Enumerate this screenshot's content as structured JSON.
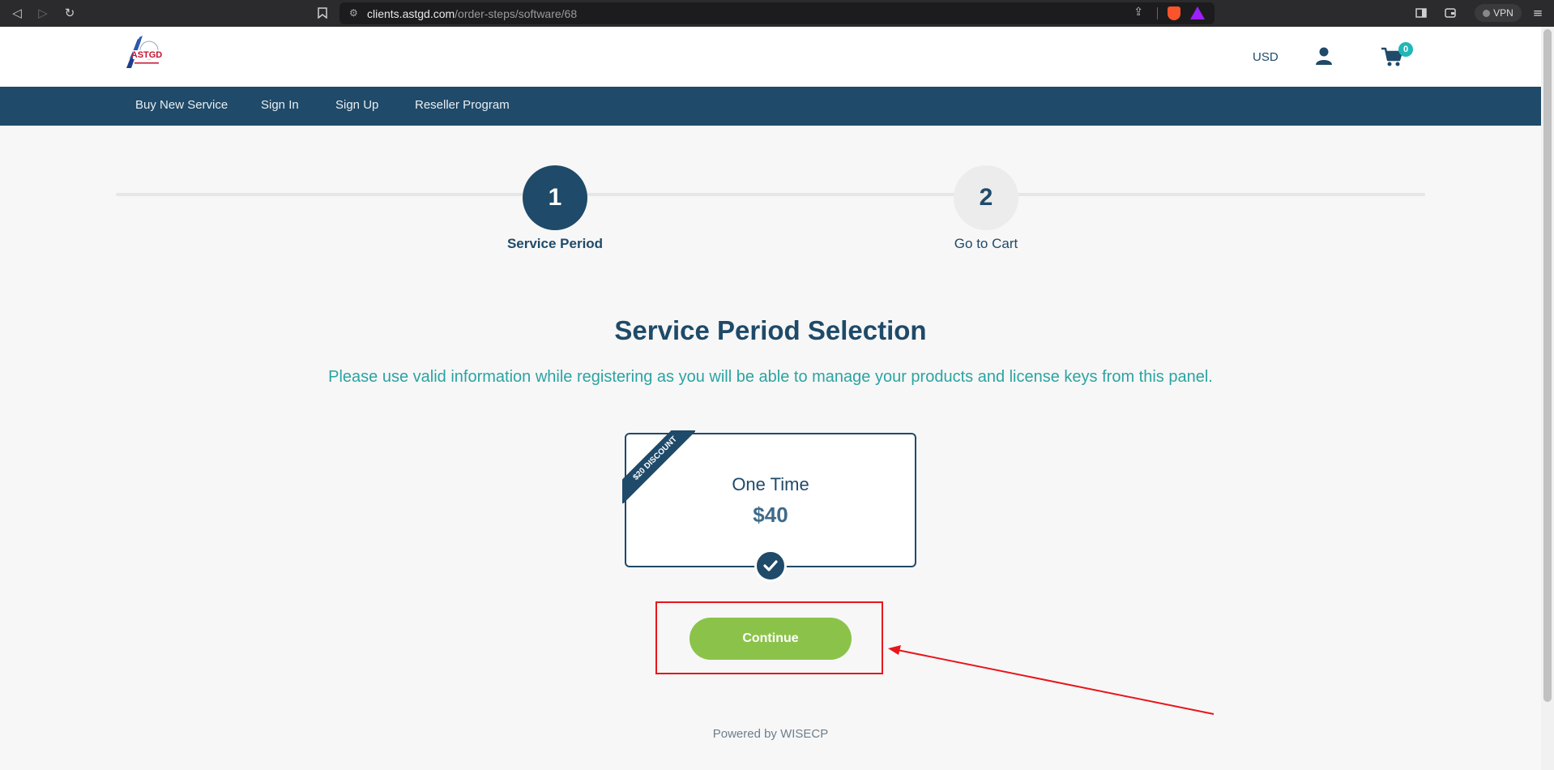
{
  "browser": {
    "url_domain": "clients.astgd.com",
    "url_path": "/order-steps/software/68",
    "vpn_label": "VPN"
  },
  "header": {
    "currency": "USD",
    "cart_count": "0"
  },
  "nav": {
    "items": [
      "Buy New Service",
      "Sign In",
      "Sign Up",
      "Reseller Program"
    ]
  },
  "steps": [
    {
      "number": "1",
      "label": "Service Period",
      "active": true
    },
    {
      "number": "2",
      "label": "Go to Cart",
      "active": false
    }
  ],
  "main": {
    "title": "Service Period Selection",
    "subtitle": "Please use valid information while registering as you will be able to manage your products and license keys from this panel."
  },
  "period_card": {
    "ribbon": "$20 DISCOUNT",
    "name": "One Time",
    "price": "$40",
    "selected": true
  },
  "actions": {
    "continue_label": "Continue"
  },
  "footer": {
    "powered_by": "Powered by WISECP"
  },
  "colors": {
    "primary": "#1f4a69",
    "accent": "#2ca3a3",
    "button": "#8bc34a",
    "annotation": "#e8161b"
  }
}
